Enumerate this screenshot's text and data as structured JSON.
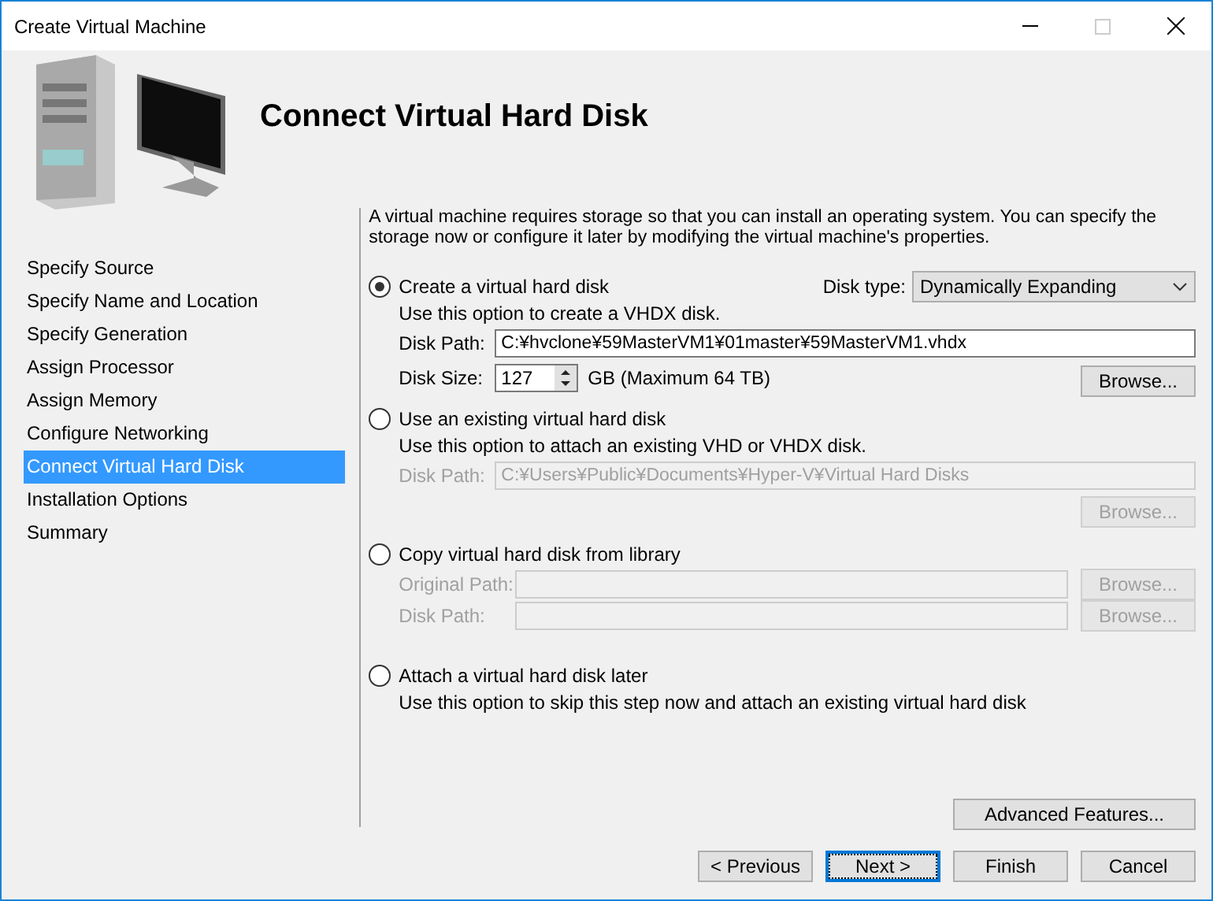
{
  "window": {
    "title": "Create Virtual Machine"
  },
  "header": {
    "title": "Connect Virtual Hard Disk"
  },
  "steps": [
    {
      "label": "Specify Source",
      "selected": false
    },
    {
      "label": "Specify Name and Location",
      "selected": false
    },
    {
      "label": "Specify Generation",
      "selected": false
    },
    {
      "label": "Assign Processor",
      "selected": false
    },
    {
      "label": "Assign Memory",
      "selected": false
    },
    {
      "label": "Configure Networking",
      "selected": false
    },
    {
      "label": "Connect Virtual Hard Disk",
      "selected": true
    },
    {
      "label": "Installation Options",
      "selected": false
    },
    {
      "label": "Summary",
      "selected": false
    }
  ],
  "description": "A virtual machine requires storage so that you can install an operating system. You can specify the storage now or configure it later by modifying the virtual machine's properties.",
  "options": [
    {
      "label": "Create a virtual hard disk",
      "selected": true,
      "hint": "Use this option to create a VHDX disk.",
      "disk_type": {
        "label": "Disk type:",
        "value": "Dynamically Expanding"
      },
      "rows": [
        {
          "kind": "path",
          "label": "Disk Path:",
          "value": "C:¥hvclone¥59MasterVM1¥01master¥59MasterVM1.vhdx",
          "disabled": false
        },
        {
          "kind": "size",
          "label": "Disk Size:",
          "value": "127",
          "unit": "GB (Maximum 64 TB)",
          "disabled": false,
          "browse": "Browse..."
        }
      ]
    },
    {
      "label": "Use an existing virtual hard disk",
      "selected": false,
      "hint": "Use this option to attach an existing VHD or VHDX disk.",
      "rows": [
        {
          "kind": "path",
          "label": "Disk Path:",
          "value": "C:¥Users¥Public¥Documents¥Hyper-V¥Virtual Hard Disks",
          "disabled": true
        },
        {
          "kind": "button",
          "disabled": true,
          "browse": "Browse..."
        }
      ]
    },
    {
      "label": "Copy virtual hard disk from library",
      "selected": false,
      "rows": [
        {
          "kind": "path",
          "label": "Original Path:",
          "disabled": true,
          "browse": "Browse..."
        },
        {
          "kind": "path",
          "label": "Disk Path:",
          "disabled": true,
          "browse": "Browse..."
        }
      ]
    },
    {
      "label": "Attach a virtual hard disk later",
      "selected": false,
      "hint": "Use this option to skip this step now and attach an existing virtual hard disk"
    }
  ],
  "advanced": "Advanced Features...",
  "buttons": [
    {
      "label": "< Previous",
      "focused": false
    },
    {
      "label": "Next >",
      "focused": true
    },
    {
      "label": "Finish",
      "focused": false
    },
    {
      "label": "Cancel",
      "focused": false
    }
  ]
}
